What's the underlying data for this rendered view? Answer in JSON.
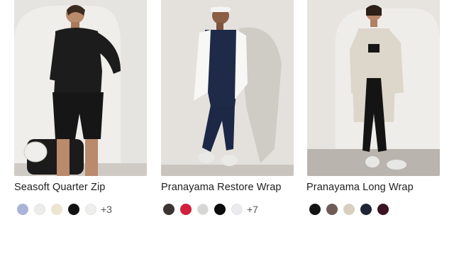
{
  "products": [
    {
      "name": "Seasoft Quarter Zip",
      "swatches": [
        "#aab4d6",
        "#ececea",
        "#ece5cf",
        "#111111",
        "#eeeeec"
      ],
      "more": "+3"
    },
    {
      "name": "Pranayama Restore Wrap",
      "swatches": [
        "#3a3533",
        "#d01f3c",
        "#d6d6d4",
        "#0c0c0c",
        "#ebebef"
      ],
      "more": "+7"
    },
    {
      "name": "Pranayama Long Wrap",
      "swatches": [
        "#141414",
        "#6f5c55",
        "#d9cfc0",
        "#1f2534",
        "#3a1422"
      ],
      "more": ""
    }
  ]
}
